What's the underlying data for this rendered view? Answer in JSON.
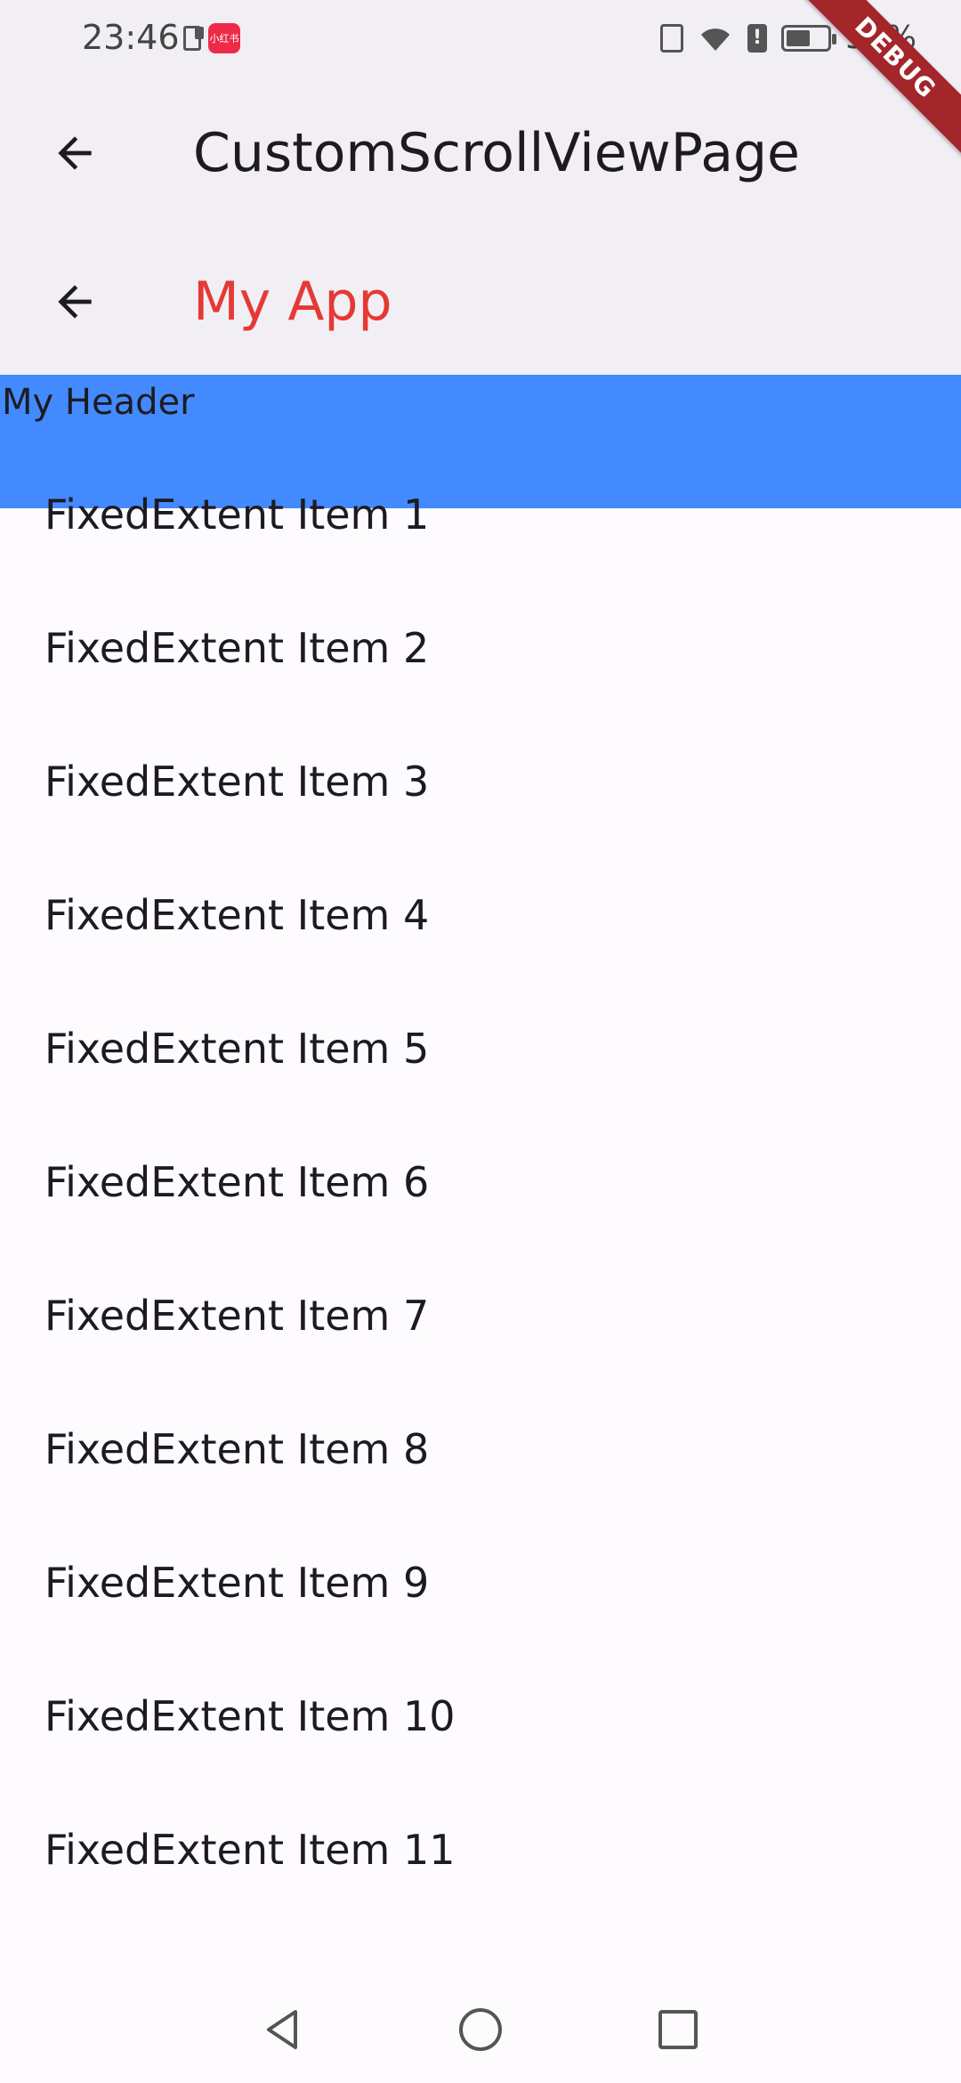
{
  "status_bar": {
    "time": "23:46",
    "app_badge": "小红书",
    "battery": "55%"
  },
  "debug_ribbon": "DEBUG",
  "appbar_primary": {
    "title": "CustomScrollViewPage"
  },
  "appbar_secondary": {
    "title": "My App",
    "title_color": "#e53935"
  },
  "header": {
    "text": "My Header",
    "background": "#448aff"
  },
  "list": {
    "items": [
      "FixedExtent Item 1",
      "FixedExtent Item 2",
      "FixedExtent Item 3",
      "FixedExtent Item 4",
      "FixedExtent Item 5",
      "FixedExtent Item 6",
      "FixedExtent Item 7",
      "FixedExtent Item 8",
      "FixedExtent Item 9",
      "FixedExtent Item 10",
      "FixedExtent Item 11"
    ]
  },
  "icons": {
    "back": "arrow-left",
    "nav_back": "triangle-left",
    "nav_home": "circle",
    "nav_recents": "square"
  }
}
